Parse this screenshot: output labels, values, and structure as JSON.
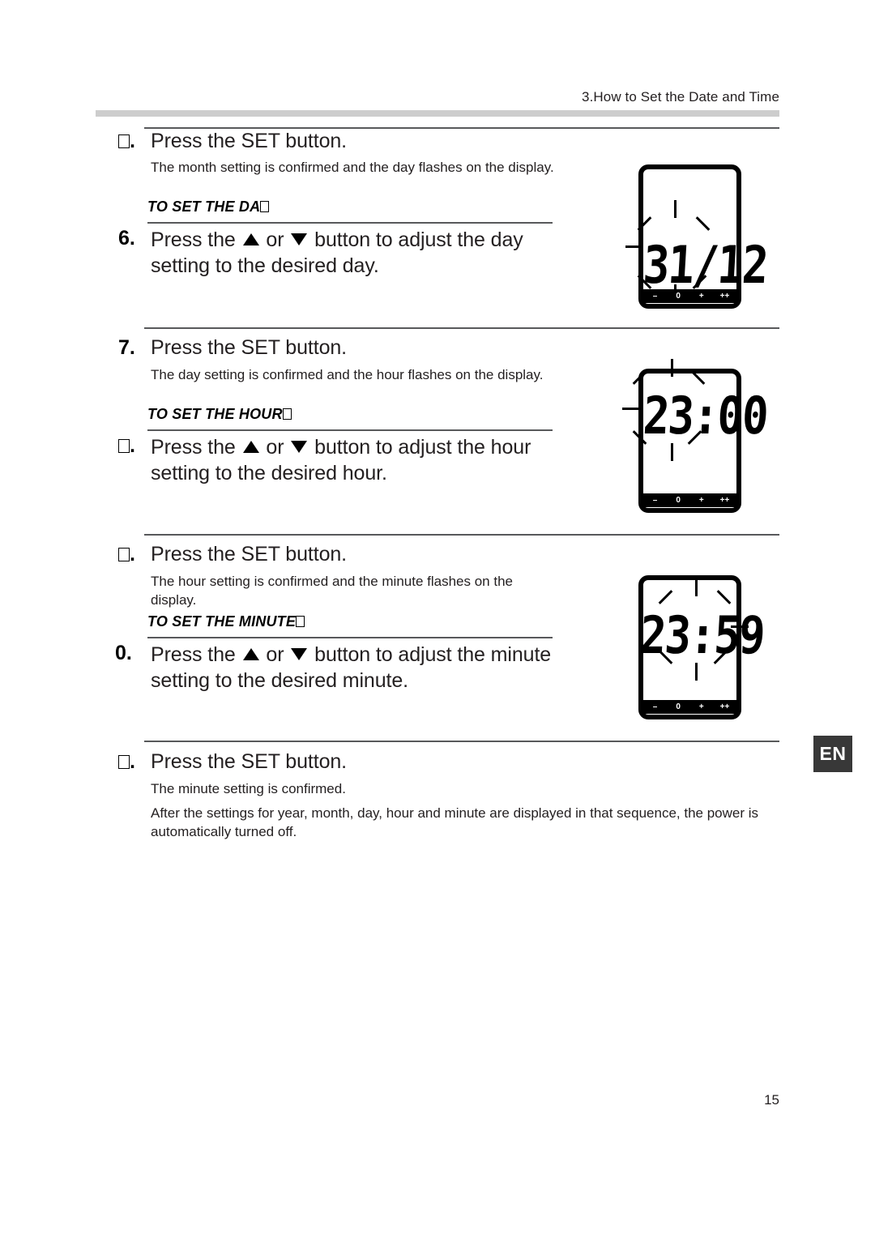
{
  "header": {
    "running_head": "3.How to Set the Date and Time"
  },
  "language_tab": {
    "label": "EN"
  },
  "page_number": "15",
  "lcd_buttons": {
    "minus": "–",
    "zero": "0",
    "plus": "+",
    "plus_plus": "++"
  },
  "steps": [
    {
      "number": "",
      "number_missing_glyph": true,
      "title": "Press the SET button.",
      "body": "The month setting is confirmed and the day flashes on the display.",
      "sub_head": "TO SET THE DA",
      "sub_head_missing_glyph": true
    },
    {
      "number": "6.",
      "number_missing_glyph": false,
      "title_pre": "Press the",
      "title_mid": "or",
      "title_post": "button to adjust the day setting to the desired day."
    },
    {
      "number": "7.",
      "number_missing_glyph": false,
      "title": "Press the SET button.",
      "body": "The day setting is confirmed and the hour flashes on the display.",
      "sub_head": "TO SET THE HOUR",
      "sub_head_missing_glyph": true
    },
    {
      "number": "",
      "number_missing_glyph": true,
      "title_pre": "Press the",
      "title_mid": "or",
      "title_post": "button to adjust the hour setting to the desired hour."
    },
    {
      "number": "",
      "number_missing_glyph": true,
      "title": "Press the SET button.",
      "body": "The hour setting is confirmed and the minute flashes on the display.",
      "sub_head": "TO SET THE MINUTE",
      "sub_head_missing_glyph": true
    },
    {
      "number": "0.",
      "number_missing_glyph": false,
      "title_pre": "Press the",
      "title_mid": "or",
      "title_post": "button to adjust the minute setting to the desired minute."
    },
    {
      "number": "",
      "number_missing_glyph": true,
      "title": "Press the SET button.",
      "body": "The minute setting is confirmed.",
      "body2": "After the settings for year, month, day, hour and minute are displayed in that sequence, the power is automatically turned off."
    }
  ],
  "displays": [
    {
      "name": "day-display",
      "value": "31/12",
      "flashing_part": "day"
    },
    {
      "name": "hour-display",
      "value": "23:00",
      "flashing_part": "hour"
    },
    {
      "name": "minute-display",
      "value": "23:59",
      "flashing_part": "minute"
    }
  ]
}
